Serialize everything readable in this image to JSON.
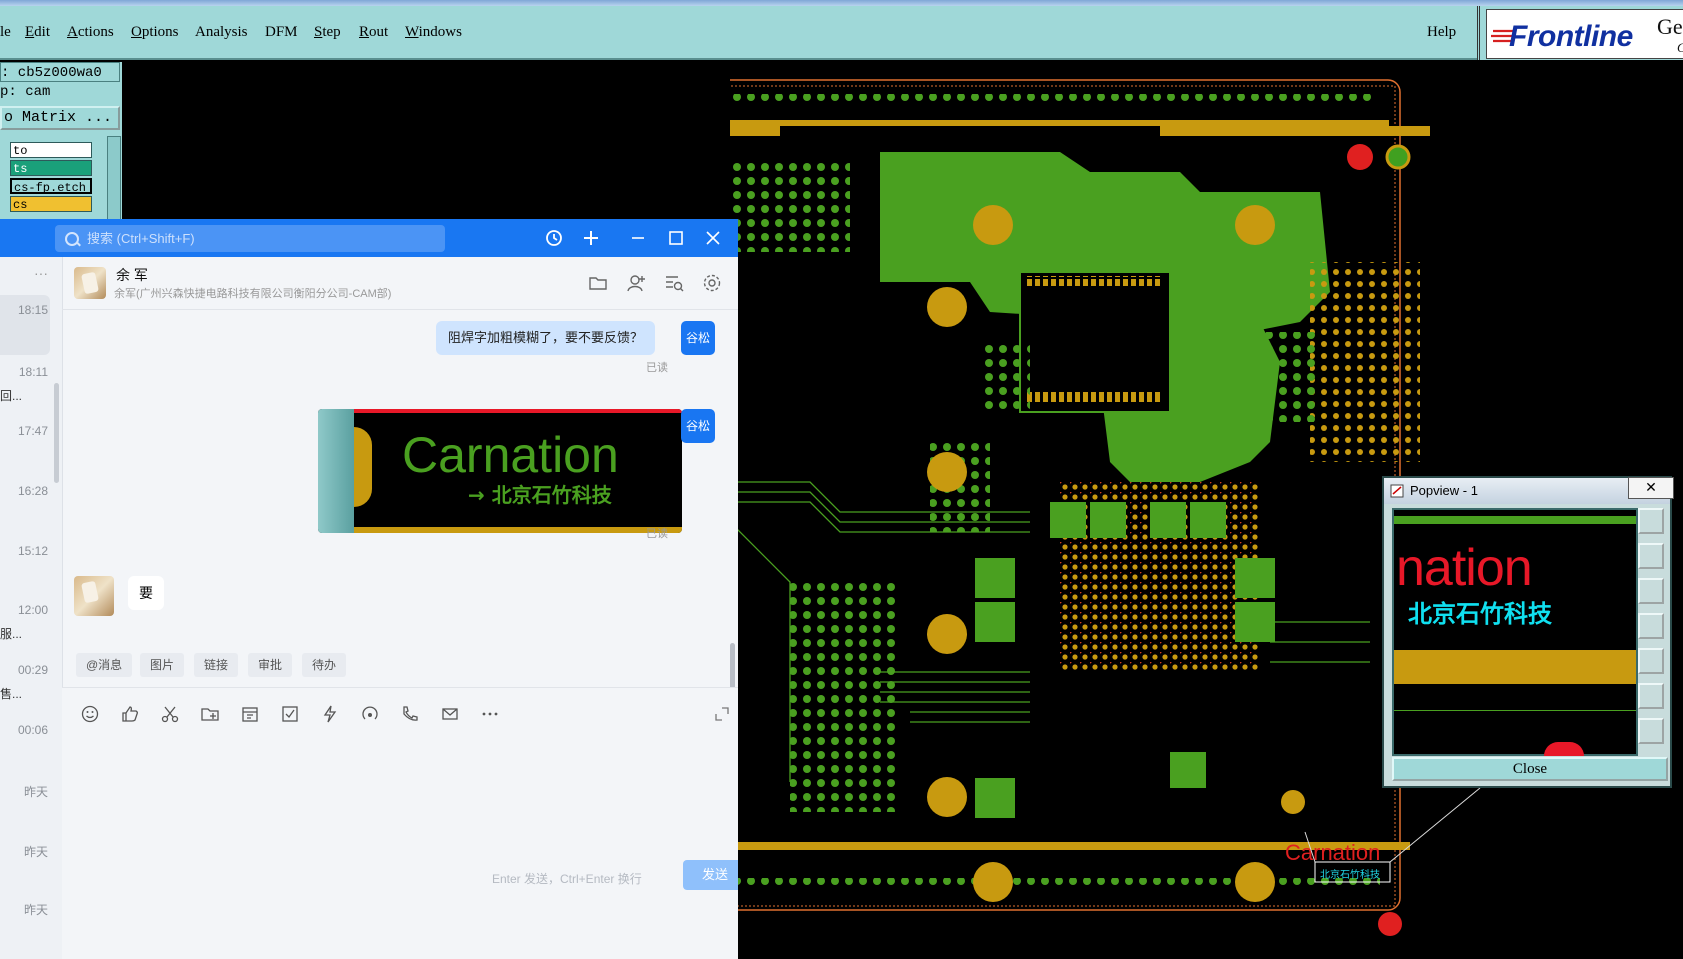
{
  "cam": {
    "menu": [
      "le",
      "Edit",
      "Actions",
      "Options",
      "Analysis",
      "DFM",
      "Step",
      "Rout",
      "Windows"
    ],
    "menu_underline": [
      "",
      "E",
      "A",
      "O",
      "",
      "",
      "S",
      "R",
      "W"
    ],
    "help": "Help",
    "logo": {
      "brand": "Frontline",
      "product": "Ger",
      "sub": "Gr"
    },
    "job_field": ": cb5z000wa0",
    "step_field": "p: cam",
    "matrix_button": "o Matrix ...",
    "layers": [
      {
        "name": "to",
        "color": "#ffffff"
      },
      {
        "name": "ts",
        "color": "#1aa07a"
      },
      {
        "name": "cs-fp.etch",
        "color": "#9fd8d8"
      },
      {
        "name": "cs",
        "color": "#f0c030"
      }
    ],
    "popview": {
      "title": "Popview - 1",
      "close_x": "✕",
      "close_button": "Close",
      "preview_text": "nation",
      "preview_cn": "北京石竹科技",
      "tools": [
        "zoom-fit-icon",
        "zoom-in-icon",
        "zoom-out-icon",
        "pan-left-icon",
        "pan-right-icon",
        "fit-all-icon",
        "center-icon"
      ]
    },
    "silk_text": "Carnation",
    "silk_cn": "北京石竹科技"
  },
  "chat": {
    "search_placeholder": "搜索 (Ctrl+Shift+F)",
    "contact_name": "余 军",
    "contact_org": "余军(广州兴森快捷电路科技有限公司衡阳分公司-CAM部)",
    "conv_times": [
      "18:15",
      "18:11",
      "17:47",
      "16:28",
      "15:12",
      "12:00",
      "00:29",
      "00:06",
      "昨天",
      "昨天",
      "昨天"
    ],
    "conv_previews": [
      "",
      "回...",
      "",
      "",
      "",
      "服...",
      "售...",
      "",
      "",
      "",
      ""
    ],
    "more": "···",
    "messages": [
      {
        "text": "阻焊字加粗模糊了，要不要反馈？",
        "read": "已读",
        "avatar": "谷松"
      },
      {
        "image_text": "Carnation",
        "image_cn": "→ 北京石竹科技",
        "read": "已读",
        "avatar": "谷松"
      },
      {
        "text": "要"
      }
    ],
    "quick_actions": [
      "@消息",
      "图片",
      "链接",
      "审批",
      "待办"
    ],
    "hint": "Enter 发送，Ctrl+Enter 换行",
    "send": "发送"
  }
}
